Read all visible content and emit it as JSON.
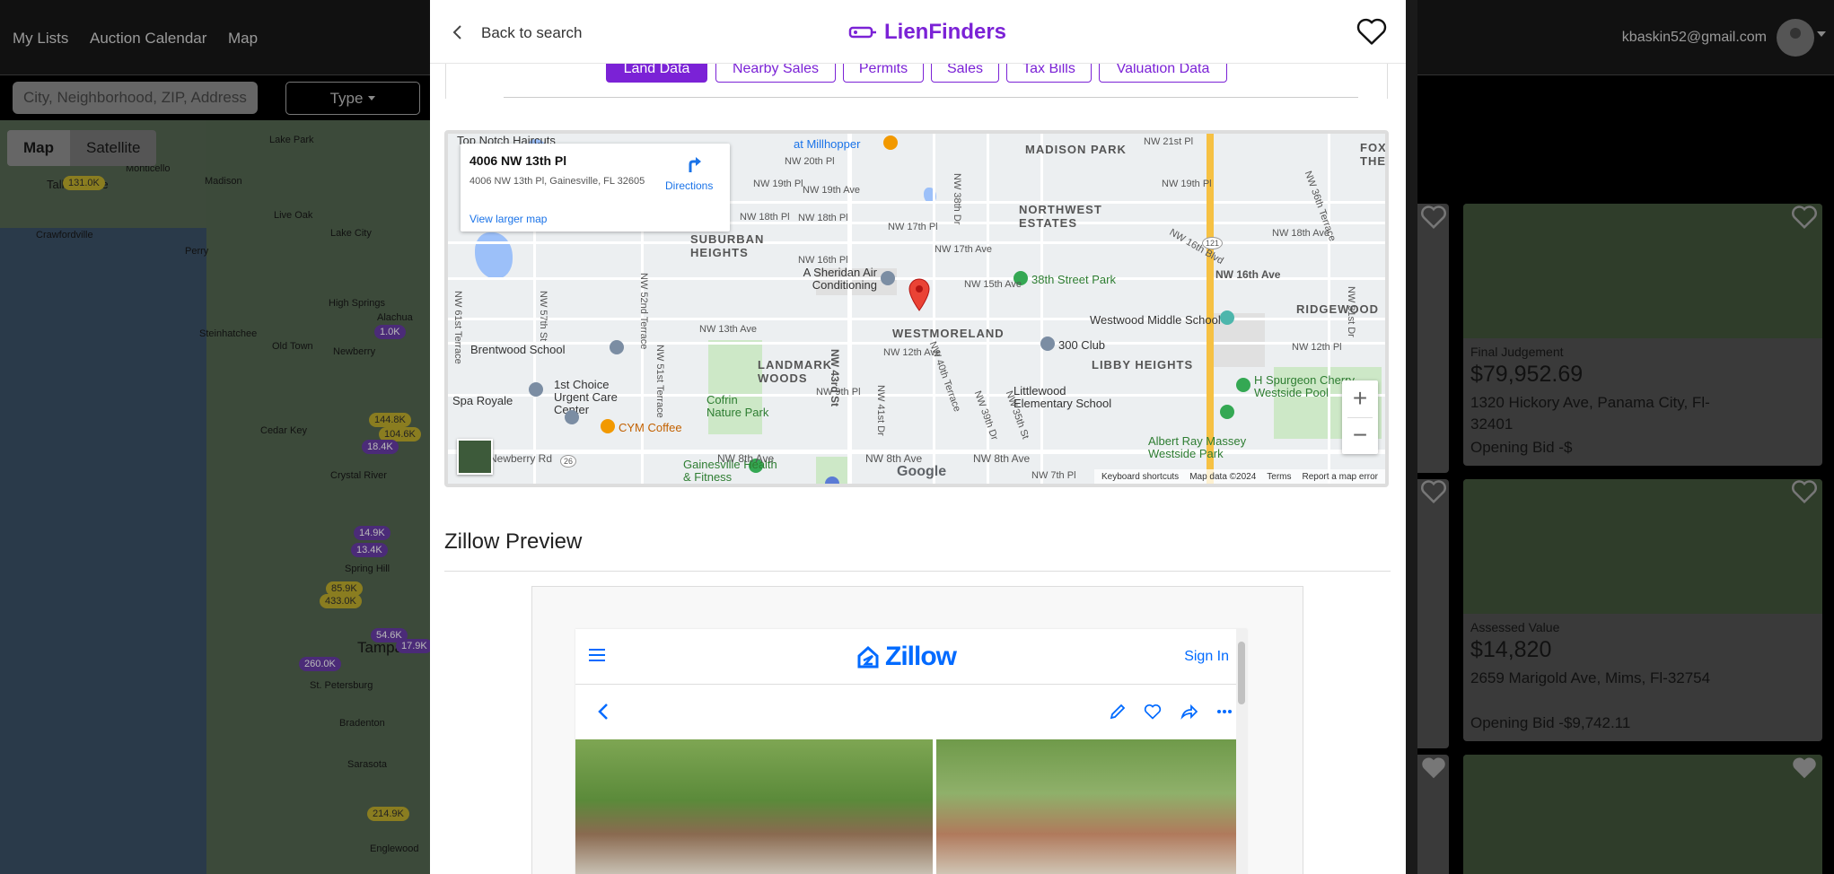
{
  "nav": {
    "links": [
      "My Lists",
      "Auction Calendar",
      "Map"
    ],
    "user_email": "kbaskin52@gmail.com"
  },
  "filters": {
    "search_placeholder": "City, Neighborhood, ZIP, Address",
    "type_label": "Type"
  },
  "bg_map": {
    "toggle": [
      "Map",
      "Satellite"
    ],
    "places": [
      "Lake Park",
      "Monticello",
      "Madison",
      "Live Oak",
      "Lake City",
      "Crawfordville",
      "Perry",
      "Steinhatchee",
      "High Springs",
      "Alachua",
      "Old Town",
      "Newberry",
      "Cedar Key",
      "Crystal River",
      "Spring Hill",
      "St. Petersburg",
      "Bradenton",
      "Sarasota",
      "Englewood",
      "Tampa",
      "Tallahassee"
    ],
    "clusters": [
      "131.0K",
      "1.0K",
      "144.8K",
      "104.6K",
      "18.4K",
      "14.9K",
      "13.4K",
      "85.9K",
      "433.0K",
      "54.6K",
      "17.9K",
      "260.0K",
      "214.9K"
    ]
  },
  "cards": [
    {
      "type": "Final Judgement",
      "amount": "$79,952.69",
      "address": "1320 Hickory Ave, Panama City, Fl-32401",
      "opening_bid": "Opening Bid -$"
    },
    {
      "type": "Assessed Value",
      "amount": "$14,820",
      "address": "2659 Marigold Ave, Mims, Fl-32754",
      "opening_bid": "Opening Bid -$9,742.11"
    }
  ],
  "modal": {
    "back_label": "Back to search",
    "brand": "LienFinders",
    "tabs": [
      "Land Data",
      "Nearby Sales",
      "Permits",
      "Sales",
      "Tax Bills",
      "Valuation Data"
    ],
    "active_tab": "Land Data",
    "map": {
      "info_title": "4006 NW 13th Pl",
      "info_address": "4006 NW 13th Pl, Gainesville, FL 32605",
      "directions": "Directions",
      "view_larger": "View larger map",
      "footer": [
        "Keyboard shortcuts",
        "Map data ©2024",
        "Terms",
        "Report a map error"
      ],
      "google": "Google",
      "areas": [
        "MADISON PARK",
        "NORTHWEST ESTATES",
        "SUBURBAN HEIGHTS",
        "WESTMORELAND",
        "LANDMARK WOODS",
        "LIBBY HEIGHTS",
        "RIDGEWOOD",
        "FOX THE"
      ],
      "pois": [
        "Top Notch Haircuts",
        "at Millhopper",
        "A Sheridan Air Conditioning",
        "38th Street Park",
        "Westwood Middle School",
        "Brentwood School",
        "1st Choice Urgent Care Center",
        "Spa Royale",
        "Cofrin Nature Park",
        "CYM Coffee",
        "300 Club",
        "Littlewood Elementary School",
        "H Spurgeon Cherry Westside Pool",
        "Albert Ray Massey Westside Park",
        "Gainesville Health & Fitness"
      ],
      "streets": [
        "NW 20th Pl",
        "NW 19th Pl",
        "NW 19th Ave",
        "NW 18th Pl",
        "NW 18th Pl",
        "NW 17th Pl",
        "NW 17th Ave",
        "NW 16th Pl",
        "NW 16th Blvd",
        "NW 15th Ave",
        "NW 16th Ave",
        "NW 13th Ave",
        "NW 12th Ave",
        "NW 12th Pl",
        "NW 9th Pl",
        "NW 8th Ave",
        "NW 8th Ave",
        "NW 8th Ave",
        "NW 7th Pl",
        "NW 21st Pl",
        "NW 19th Pl",
        "NW 18th Ave",
        "NW 43rd St",
        "NW 40th Terrace",
        "NW 38th Dr",
        "NW 36th Terrace",
        "NW 31st Dr",
        "NW 52nd Terrace",
        "NW 51st Terrace",
        "NW 57th St",
        "NW 61st Terrace",
        "Newberry Rd",
        "NW 41st Dr",
        "NW 39th Dr",
        "NW 35th St"
      ],
      "route_shields": [
        "121",
        "26"
      ]
    },
    "zillow": {
      "heading": "Zillow Preview",
      "brand": "Zillow",
      "sign_in": "Sign In"
    }
  },
  "colors": {
    "brand_purple": "#7b22d6",
    "zillow_blue": "#006aff",
    "link_blue": "#1a73e8",
    "highway_yellow": "#f6c143"
  }
}
